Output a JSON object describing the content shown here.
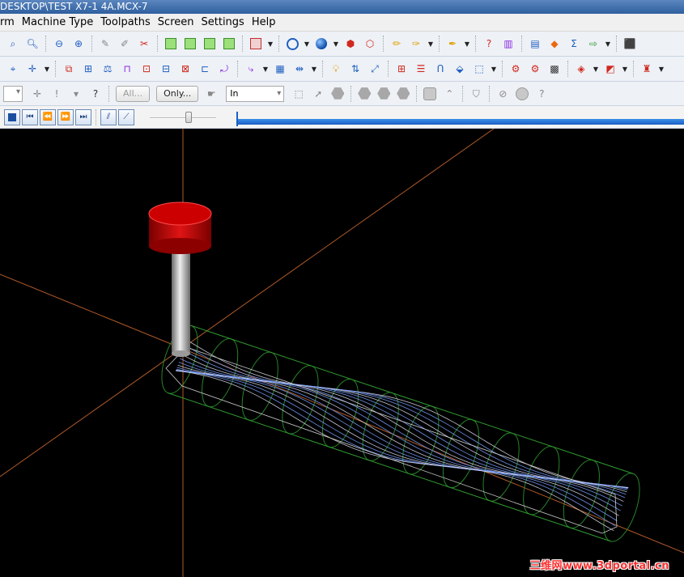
{
  "window": {
    "title": "DESKTOP\\TEST X7-1 4A.MCX-7"
  },
  "menu": {
    "items": [
      {
        "label": "rm"
      },
      {
        "label": "Machine Type"
      },
      {
        "label": "Toolpaths"
      },
      {
        "label": "Screen"
      },
      {
        "label": "Settings"
      },
      {
        "label": "Help"
      }
    ]
  },
  "toolbar3": {
    "all_button": "All...",
    "only_button": "Only...",
    "units_select": "In"
  },
  "viewport": {
    "background": "#000000",
    "tool_holder_color": "#cc0000",
    "toolpath_color": "#7aa0ff",
    "stock_outline_color": "#2f9a2f",
    "axis_color": "#b05a28"
  },
  "watermark": {
    "text": "三维网www.3dportal.cn"
  }
}
